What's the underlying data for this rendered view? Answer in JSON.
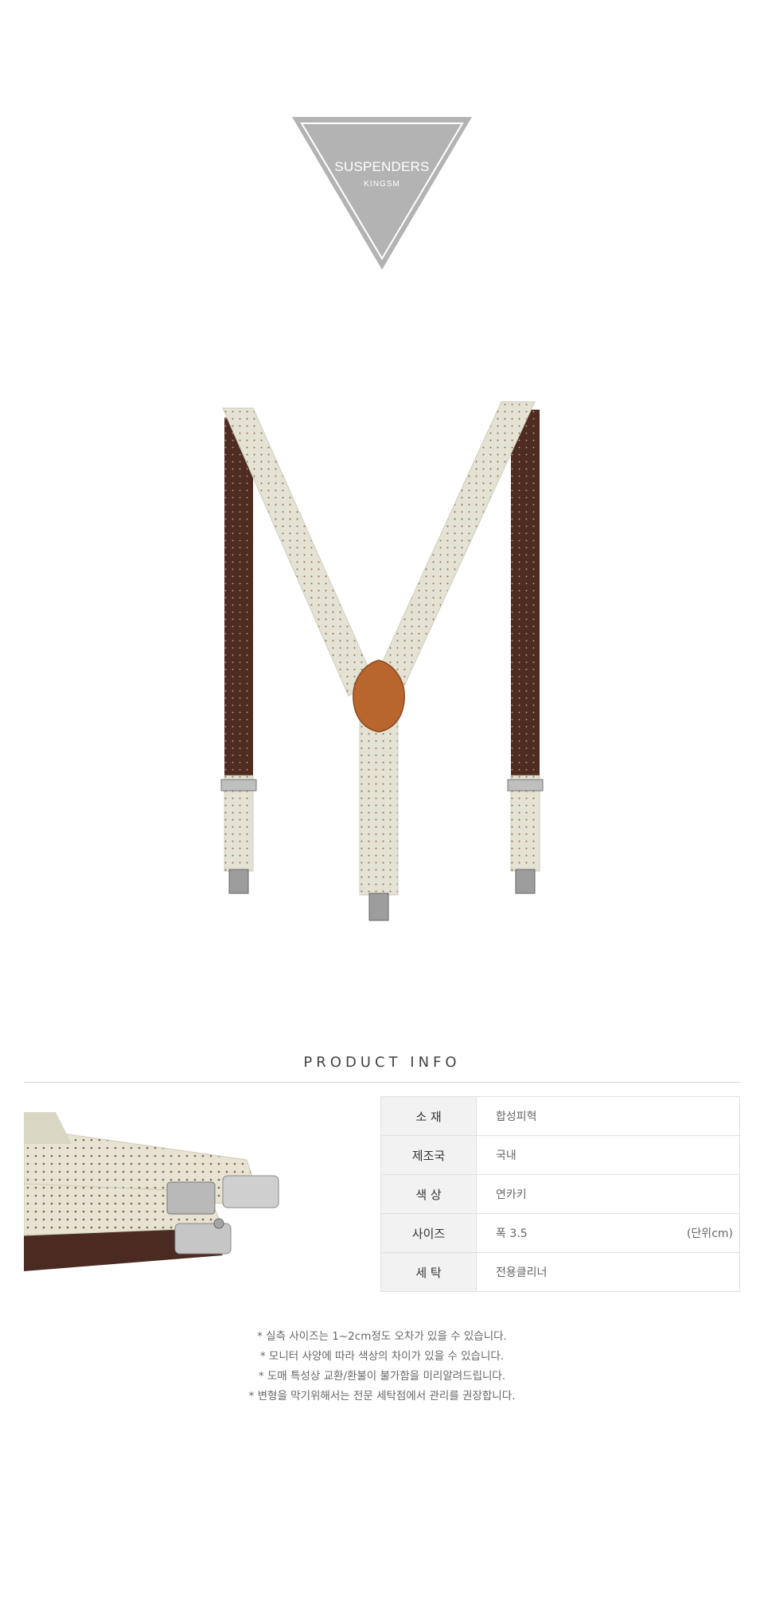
{
  "logo": {
    "title": "SUSPENDERS",
    "subtitle": "KINGSM"
  },
  "product_info": {
    "title": "PRODUCT INFO",
    "rows": [
      {
        "label": "소  재",
        "value": "합성피혁",
        "unit": ""
      },
      {
        "label": "제조국",
        "value": "국내",
        "unit": ""
      },
      {
        "label": "색  상",
        "value": "연카키",
        "unit": ""
      },
      {
        "label": "사이즈",
        "value": "폭 3.5",
        "unit": "(단위cm)"
      },
      {
        "label": "세  탁",
        "value": "전용클리너",
        "unit": ""
      }
    ]
  },
  "notes": [
    "* 실측 사이즈는 1~2cm정도 오차가 있을 수 있습니다.",
    "* 모니터 사양에 따라 색상의 차이가 있을 수 있습니다.",
    "* 도매 특성상 교환/환불이 불가함을 미리알려드립니다.",
    "* 변형을 막기위해서는 전문 세탁점에서 관리를 권장합니다."
  ]
}
